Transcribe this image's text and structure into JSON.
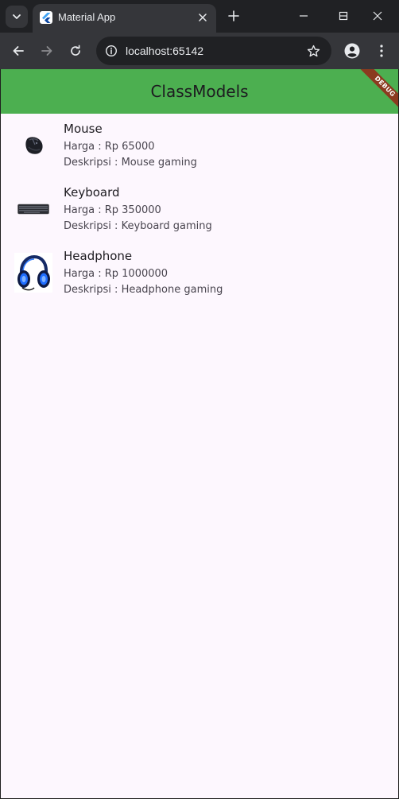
{
  "browser": {
    "tab_title": "Material App",
    "url": "localhost:65142"
  },
  "app": {
    "title": "ClassModels",
    "debug_label": "DEBUG",
    "accent_color": "#4caf50"
  },
  "products": [
    {
      "name": "Mouse",
      "price_label": "Harga : ",
      "price": "Rp 65000",
      "desc_label": "Deskripsi : ",
      "desc": "Mouse gaming",
      "image": "mouse-image"
    },
    {
      "name": "Keyboard",
      "price_label": "Harga : ",
      "price": "Rp 350000",
      "desc_label": "Deskripsi : ",
      "desc": "Keyboard gaming",
      "image": "keyboard-image"
    },
    {
      "name": "Headphone",
      "price_label": "Harga : ",
      "price": "Rp 1000000",
      "desc_label": "Deskripsi : ",
      "desc": "Headphone gaming",
      "image": "headphone-image"
    }
  ]
}
